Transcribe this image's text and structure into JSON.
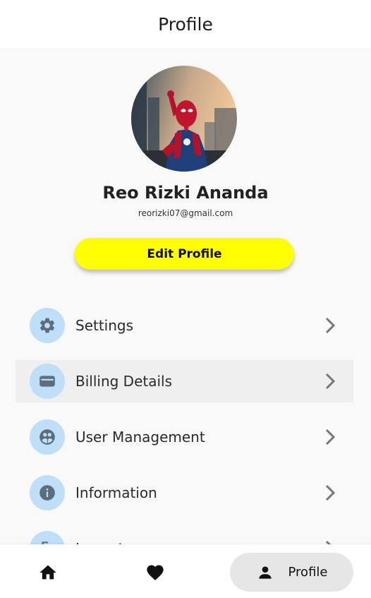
{
  "app_bar": {
    "title": "Profile"
  },
  "user": {
    "name": "Reo Rizki Ananda",
    "email": "reorizki07@gmail.com"
  },
  "edit_button": {
    "label": "Edit Profile",
    "color": "#ffff00"
  },
  "menu": [
    {
      "label": "Settings",
      "icon": "gear-icon"
    },
    {
      "label": "Billing Details",
      "icon": "wallet-icon",
      "highlighted": true
    },
    {
      "label": "User Management",
      "icon": "user-management-icon"
    },
    {
      "label": "Information",
      "icon": "info-icon"
    },
    {
      "label": "Logout",
      "icon": "logout-icon"
    }
  ],
  "colors": {
    "icon_circle_bg": "#bfdff8",
    "icon_color": "#5c6d7e",
    "accent_yellow": "#ffff00",
    "highlight_row": "#efefef"
  },
  "bottom_nav": {
    "items": [
      {
        "icon": "home-icon"
      },
      {
        "icon": "heart-icon"
      },
      {
        "icon": "person-icon",
        "label": "Profile",
        "active": true
      }
    ]
  }
}
